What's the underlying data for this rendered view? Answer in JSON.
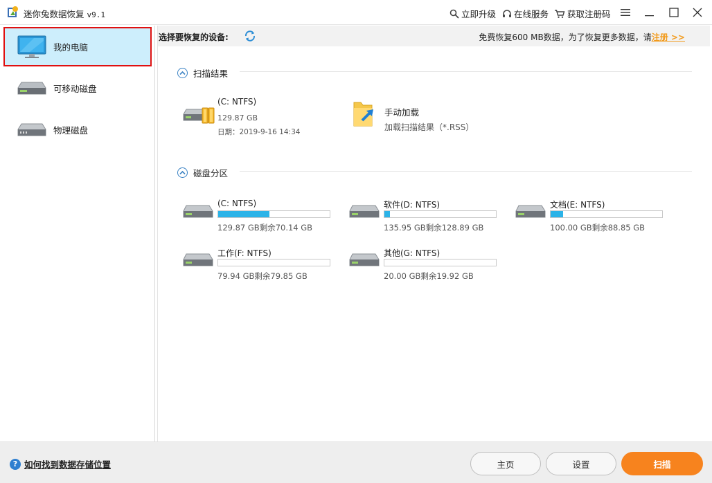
{
  "window": {
    "title": "迷你兔数据恢复",
    "version": "v9.1"
  },
  "top_actions": {
    "upgrade": "立即升级",
    "online_service": "在线服务",
    "get_code": "获取注册码"
  },
  "sidebar": {
    "items": [
      {
        "label": "我的电脑",
        "icon": "monitor-icon",
        "active": true
      },
      {
        "label": "可移动磁盘",
        "icon": "removable-disk-icon",
        "active": false
      },
      {
        "label": "物理磁盘",
        "icon": "physical-disk-icon",
        "active": false
      }
    ]
  },
  "main": {
    "device_label": "选择要恢复的设备:",
    "free_note": "免费恢复600 MB数据，为了恢复更多数据，请",
    "register_link": "注册 >>",
    "scan_section_title": "扫描结果",
    "partition_section_title": "磁盘分区",
    "scan_result": {
      "name": "(C: NTFS)",
      "size": "129.87 GB",
      "date": "日期：2019-9-16 14:34"
    },
    "manual_load": {
      "title": "手动加载",
      "subtitle": "加载扫描结果（*.RSS）"
    },
    "partitions": [
      {
        "name": "(C: NTFS)",
        "capacity": "129.87 GB剩余70.14 GB",
        "used_fraction": 0.46
      },
      {
        "name": "软件(D: NTFS)",
        "capacity": "135.95 GB剩余128.89 GB",
        "used_fraction": 0.05
      },
      {
        "name": "文档(E: NTFS)",
        "capacity": "100.00 GB剩余88.85 GB",
        "used_fraction": 0.11
      },
      {
        "name": "工作(F: NTFS)",
        "capacity": "79.94 GB剩余79.85 GB",
        "used_fraction": 0.0
      },
      {
        "name": "其他(G: NTFS)",
        "capacity": "20.00 GB剩余19.92 GB",
        "used_fraction": 0.0
      }
    ]
  },
  "footer": {
    "help_text": "如何找到数据存储位置",
    "home_button": "主页",
    "settings_button": "设置",
    "scan_button": "扫描"
  },
  "colors": {
    "accent_orange": "#f7831e",
    "bar_blue": "#2bb3e8",
    "active_bg": "#cdeefc",
    "highlight_red": "#e01010"
  }
}
